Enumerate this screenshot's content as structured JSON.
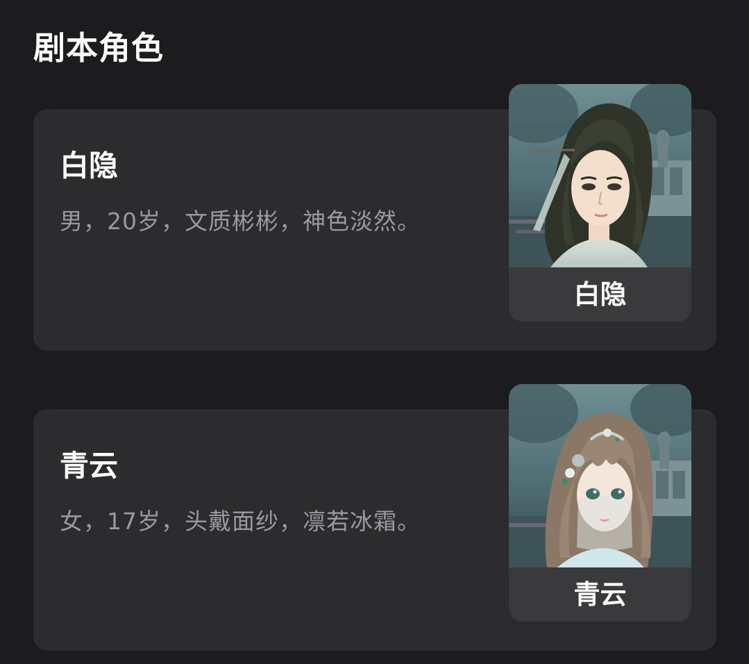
{
  "section": {
    "title": "剧本角色"
  },
  "characters": [
    {
      "name": "白隐",
      "description": "男，20岁，文质彬彬，神色淡然。",
      "tile_label": "白隐",
      "portrait_icon": "male-character-portrait"
    },
    {
      "name": "青云",
      "description": "女，17岁，头戴面纱，凛若冰霜。",
      "tile_label": "青云",
      "portrait_icon": "female-character-portrait"
    }
  ],
  "colors": {
    "background": "#1c1c1e",
    "card": "#2c2c2e",
    "tile_label_bg": "#3a3a3c",
    "description_text": "#9a9a9e"
  }
}
